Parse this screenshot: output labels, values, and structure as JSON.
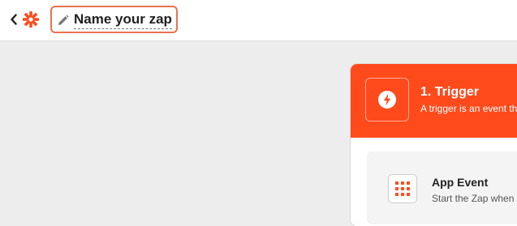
{
  "header": {
    "zap_name": "Name your zap",
    "icons": {
      "back": "chevron-left-icon",
      "logo": "zapier-logo-icon",
      "edit": "pencil-icon"
    }
  },
  "step": {
    "title": "1. Trigger",
    "description": "A trigger is an event that starts your Zap",
    "icon": "lightning-bolt-icon",
    "app_event": {
      "title": "App Event",
      "description": "Start the Zap when something happens in an app",
      "icon": "grid-icon"
    }
  },
  "colors": {
    "brand": "#ff4a1c",
    "focus_border": "#e8734f",
    "canvas": "#ededed"
  }
}
